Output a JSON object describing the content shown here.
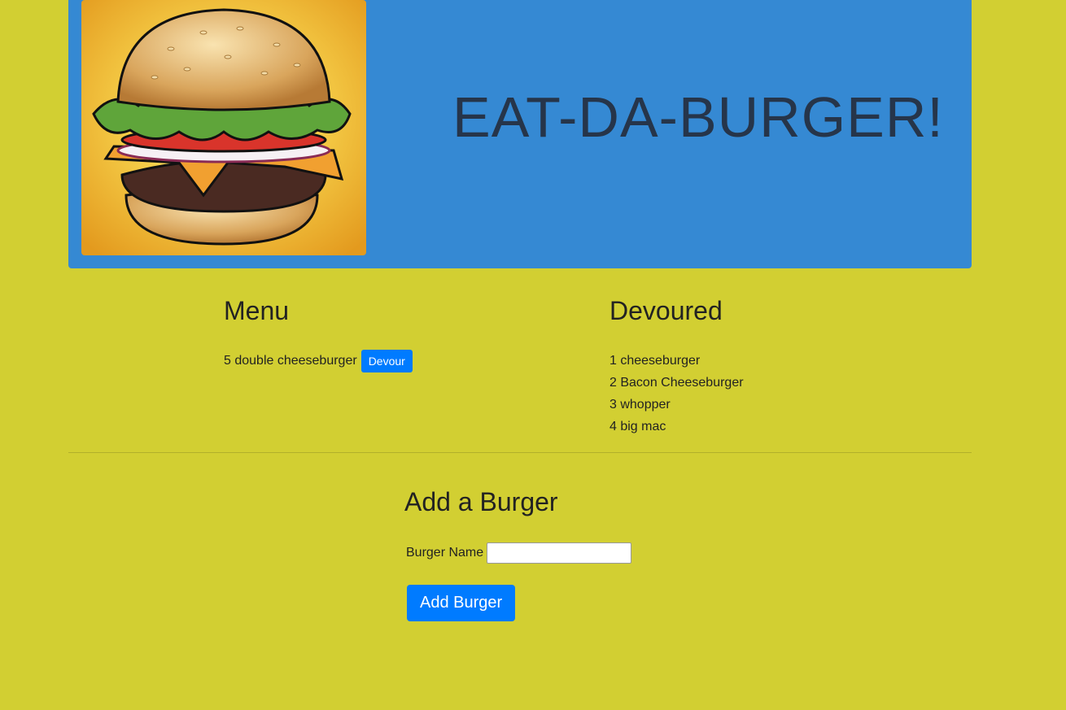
{
  "header": {
    "title": "EAT-DA-BURGER!",
    "image_icon": "burger-image"
  },
  "menu": {
    "heading": "Menu",
    "items": [
      {
        "label": "5 double cheeseburger",
        "button_label": "Devour"
      }
    ]
  },
  "devoured": {
    "heading": "Devoured",
    "items": [
      "1 cheeseburger",
      "2 Bacon Cheeseburger",
      "3 whopper",
      "4 big mac"
    ]
  },
  "add_form": {
    "heading": "Add a Burger",
    "field_label": "Burger Name",
    "field_value": "",
    "submit_label": "Add Burger"
  },
  "colors": {
    "page_background": "#d2cf32",
    "header_background": "#3589d3",
    "button_primary": "#007bff"
  }
}
